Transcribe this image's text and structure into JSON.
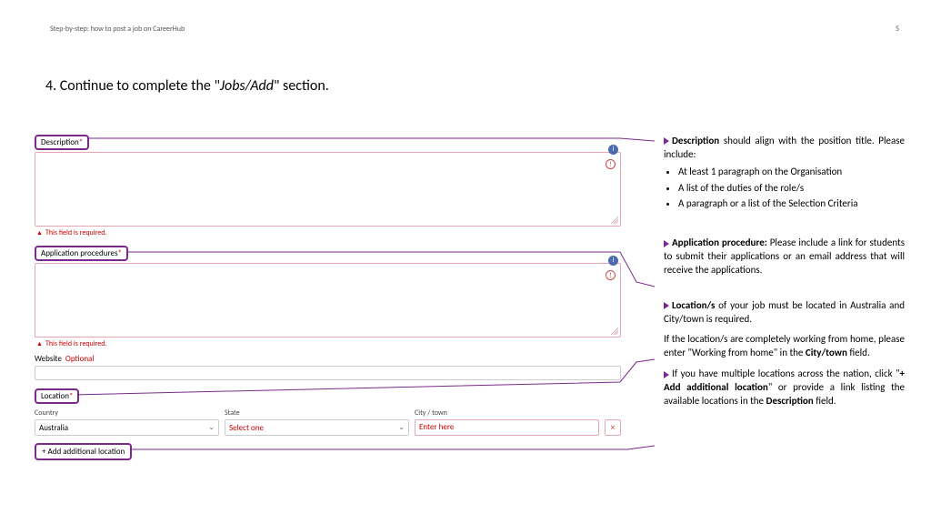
{
  "header": {
    "breadcrumb": "Step-by-step: how to post a job on CareerHub",
    "page_number": "5"
  },
  "heading": {
    "prefix": "4. Continue to complete the \"",
    "italic": "Jobs/Add",
    "suffix": "\" section."
  },
  "form": {
    "description": {
      "label": "Description",
      "star": "*",
      "required_msg": "This field is required."
    },
    "application": {
      "label": "Application procedures",
      "star": "*",
      "required_msg": "This field is required."
    },
    "website": {
      "label": "Website",
      "optional": "Optional"
    },
    "location": {
      "label": "Location",
      "star": "*",
      "country_label": "Country",
      "country_value": "Australia",
      "state_label": "State",
      "state_value": "Select one",
      "city_label": "City / town",
      "city_placeholder": "Enter here",
      "delete_icon": "×"
    },
    "add_location_btn": "+  Add additional location"
  },
  "notes": {
    "desc": {
      "lead_bold": "Description",
      "lead_rest": " should align with the position title. Please include:",
      "bullets": [
        "At least 1 paragraph on the Organisation",
        "A list of the duties of the role/s",
        "A paragraph or a list of the Selection Criteria"
      ]
    },
    "app": {
      "lead_bold": "Application procedure:",
      "lead_rest": " Please include a link for students to submit their applications or an email address that will receive the applications."
    },
    "loc": {
      "p1_bold": "Location/s",
      "p1_rest": " of your job must be located in Australia and City/town is required.",
      "p2_a": "If the location/s are completely working from home, please enter \"Working from home\" in the ",
      "p2_bold": "City/town",
      "p2_b": " field.",
      "p3_a": "If you have multiple locations across the nation, click \"",
      "p3_bold1": "+ Add additional location",
      "p3_b": "\" or provide a link listing the available locations in the ",
      "p3_bold2": "Description",
      "p3_c": " field."
    }
  }
}
